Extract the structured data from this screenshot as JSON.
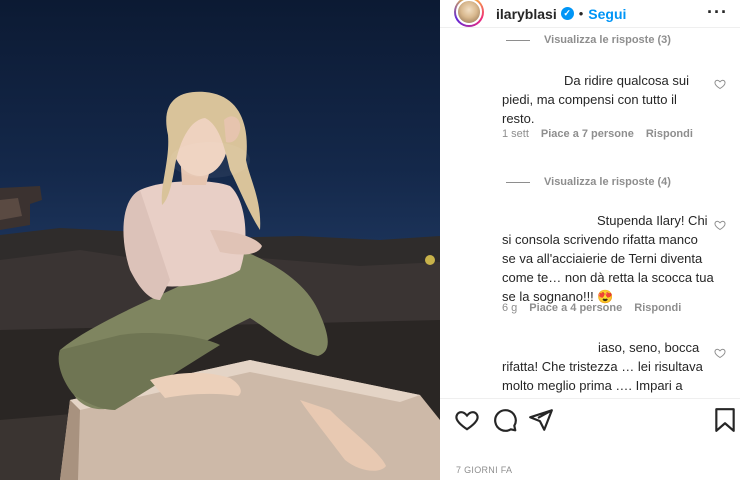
{
  "header": {
    "username": "ilaryblasi",
    "verified_mark": "✓",
    "separator": "•",
    "follow_label": "Segui",
    "more_label": "···"
  },
  "comments": [
    {
      "view_replies": "Visualizza le risposte (3)"
    },
    {
      "lines": [
        "Da ridire qualcosa sui",
        "piedi, ma compensi con tutto il",
        "resto."
      ],
      "time": "1 sett",
      "likes": "Piace a 7 persone",
      "reply": "Rispondi",
      "view_replies": "Visualizza le risposte (4)"
    },
    {
      "lines": [
        "Stupenda Ilary! Chi",
        "si consola scrivendo rifatta manco",
        "se va all'acciaierie de Terni diventa",
        "come te… non dà retta la scocca tua",
        "se la sognano!!! 😍"
      ],
      "time": "6 g",
      "likes": "Piace a 4 persone",
      "reply": "Rispondi"
    },
    {
      "lines": [
        "iaso, seno, bocca",
        "rifatta! Che tristezza … lei risultava",
        "molto meglio prima …. Impari a"
      ]
    }
  ],
  "actions": {
    "icons": [
      "heart-icon",
      "comment-icon",
      "share-icon",
      "bookmark-icon"
    ]
  },
  "post_date": "7 GIORNI FA",
  "colors": {
    "accent": "#0095f6",
    "muted": "#8e8e8e",
    "text": "#262626"
  }
}
